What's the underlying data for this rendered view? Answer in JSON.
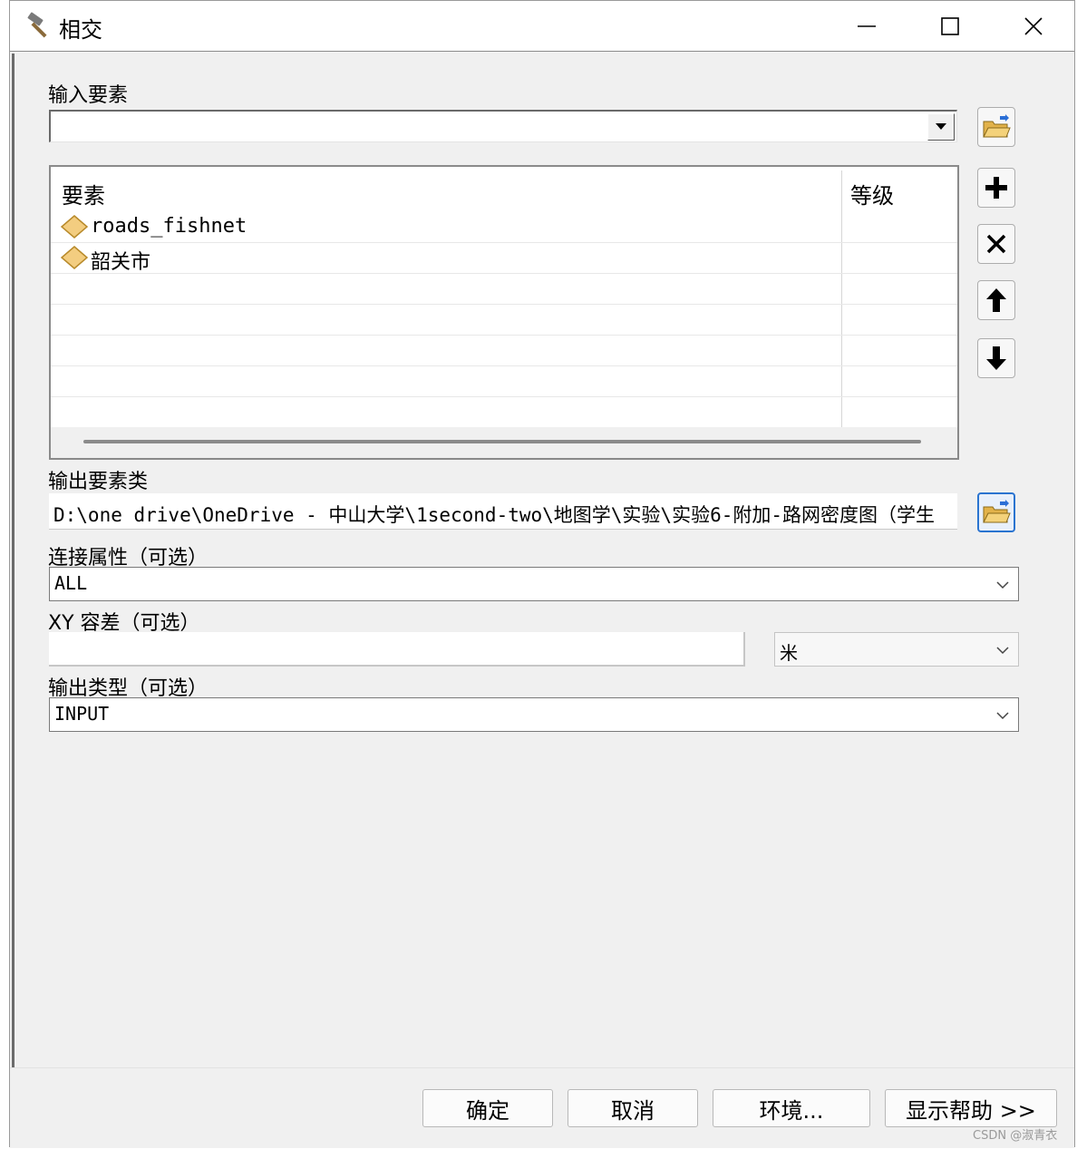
{
  "window": {
    "title": "相交",
    "controls": [
      "minimize",
      "maximize",
      "close"
    ]
  },
  "input_features": {
    "label": "输入要素",
    "value": ""
  },
  "feature_table": {
    "columns": [
      "要素",
      "等级"
    ],
    "rows": [
      {
        "name": "roads_fishnet",
        "rank": ""
      },
      {
        "name": "韶关市",
        "rank": ""
      }
    ]
  },
  "output_feature_class": {
    "label": "输出要素类",
    "value": "D:\\one drive\\OneDrive - 中山大学\\1second-two\\地图学\\实验\\实验6-附加-路网密度图（学生"
  },
  "join_attributes": {
    "label": "连接属性（可选）",
    "value": "ALL"
  },
  "xy_tolerance": {
    "label": "XY 容差（可选）",
    "value": "",
    "unit": "米"
  },
  "output_type": {
    "label": "输出类型（可选）",
    "value": "INPUT"
  },
  "footer": {
    "ok": "确定",
    "cancel": "取消",
    "environments": "环境...",
    "show_help": "显示帮助 >>",
    "watermark": "CSDN @淑青衣"
  },
  "icons": {
    "title": "hammer-icon",
    "browse": "open-folder-icon",
    "add": "plus-icon",
    "remove": "x-icon",
    "up": "arrow-up-icon",
    "down": "arrow-down-icon",
    "feature": "polygon-feature-icon"
  }
}
